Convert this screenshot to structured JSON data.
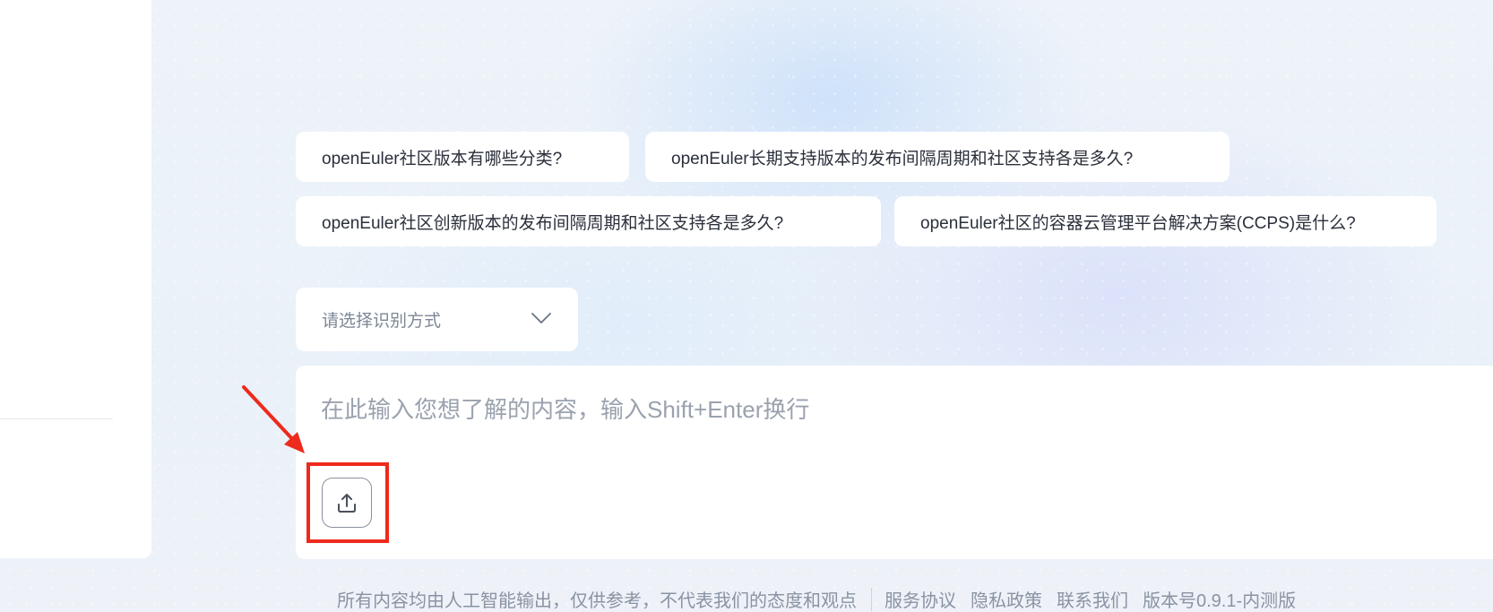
{
  "suggestions": [
    "openEuler社区版本有哪些分类?",
    "openEuler长期支持版本的发布间隔周期和社区支持各是多久?",
    "openEuler社区创新版本的发布间隔周期和社区支持各是多久?",
    "openEuler社区的容器云管理平台解决方案(CCPS)是什么?"
  ],
  "recognition_select": {
    "placeholder": "请选择识别方式"
  },
  "chat_input": {
    "placeholder": "在此输入您想了解的内容，输入Shift+Enter换行"
  },
  "upload": {
    "icon": "upload-icon"
  },
  "annotation": {
    "color": "#ee2a1c"
  },
  "footer": {
    "disclaimer": "所有内容均由人工智能输出，仅供参考，不代表我们的态度和观点",
    "terms": "服务协议",
    "privacy": "隐私政策",
    "contact": "联系我们",
    "version": "版本号0.9.1-内测版"
  }
}
